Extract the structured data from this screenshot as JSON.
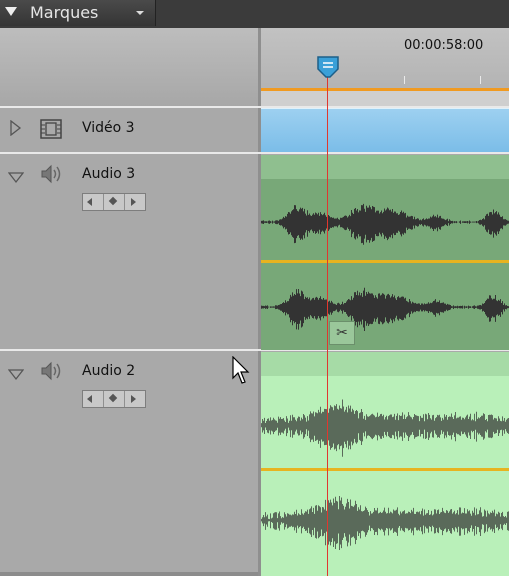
{
  "panel": {
    "title": "Marques"
  },
  "ruler": {
    "timecode": "00:00:58:00"
  },
  "tracks": [
    {
      "name": "Vidéo 3",
      "type": "video",
      "icon": "film-icon",
      "expanded": false
    },
    {
      "name": "Audio 3",
      "type": "audio",
      "icon": "speaker-icon",
      "expanded": true
    },
    {
      "name": "Audio 2",
      "type": "audio",
      "icon": "speaker-icon",
      "expanded": true
    }
  ],
  "colors": {
    "video_clip": "#7bbde8",
    "audio3_clip": "#78a878",
    "audio2_clip": "#b9f0b9",
    "playhead": "#e0372f",
    "level_line": "#e7b320",
    "work_area": "#f09a21"
  }
}
